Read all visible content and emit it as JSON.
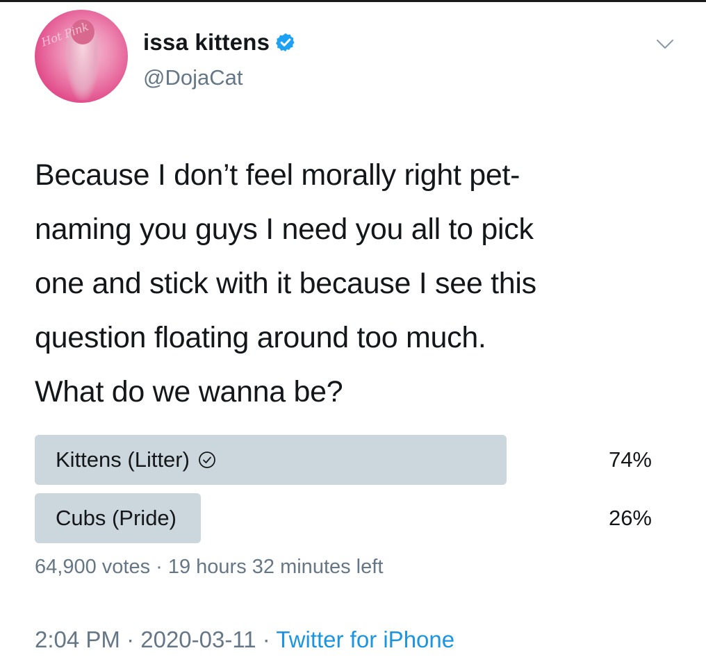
{
  "author": {
    "display_name": "issa kittens",
    "handle": "@DojaCat",
    "avatar_scribble": "Hot Pink"
  },
  "tweet": {
    "lines": [
      "Because I don’t feel morally right pet-",
      "naming you guys I need you all to pick",
      "one and stick with it because I see this",
      "question floating around too much.",
      "What do we wanna be?"
    ]
  },
  "poll": {
    "options": [
      {
        "label": "Kittens (Litter)",
        "percent_text": "74%",
        "fraction": 0.74,
        "selected": true
      },
      {
        "label": "Cubs (Pride)",
        "percent_text": "26%",
        "fraction": 0.26,
        "selected": false
      }
    ],
    "votes": "64,900 votes",
    "separator": " · ",
    "time_left": "19 hours 32 minutes left"
  },
  "meta": {
    "time": "2:04 PM",
    "date": "2020-03-11",
    "separator": " · ",
    "source": "Twitter for iPhone"
  },
  "colors": {
    "verified": "#1da1f2",
    "bar": "#ccd6dd",
    "secondary_text": "#657786",
    "link": "#1b95e0"
  },
  "icons": [
    "verified-badge-icon",
    "chevron-down-icon",
    "check-circle-icon"
  ]
}
